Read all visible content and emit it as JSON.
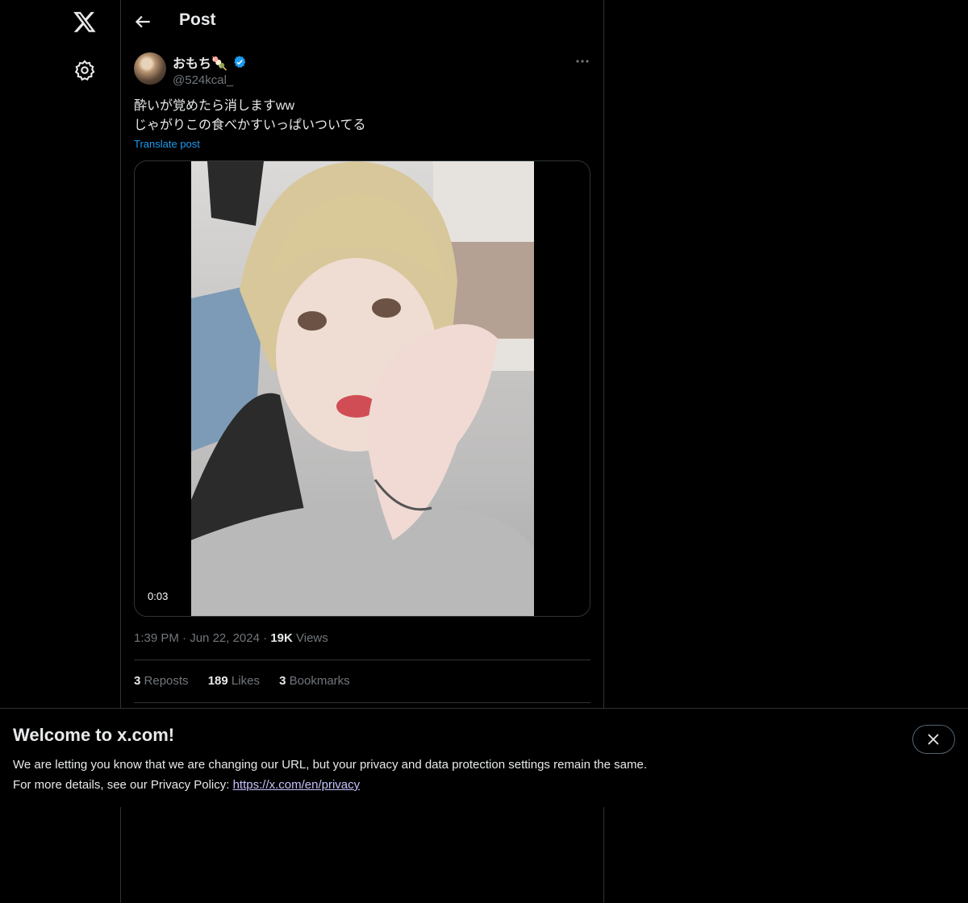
{
  "header": {
    "title": "Post"
  },
  "author": {
    "display_name": "おもち🍡",
    "handle": "@524kcal_"
  },
  "post": {
    "text": "酔いが覚めたら消しますww\nじゃがりこの食べかすいっぱいついてる",
    "translate_label": "Translate post",
    "video_duration": "0:03",
    "time": "1:39 PM",
    "date": "Jun 22, 2024",
    "views_count": "19K",
    "views_label": "Views"
  },
  "stats": {
    "reposts_count": "3",
    "reposts_label": "Reposts",
    "likes_count": "189",
    "likes_label": "Likes",
    "bookmarks_count": "3",
    "bookmarks_label": "Bookmarks"
  },
  "banner": {
    "title": "Welcome to x.com!",
    "line1": "We are letting you know that we are changing our URL, but your privacy and data protection settings remain the same.",
    "line2_prefix": "For more details, see our Privacy Policy: ",
    "link": "https://x.com/en/privacy"
  },
  "colors": {
    "background": "#000000",
    "text": "#e7e9ea",
    "muted": "#71767b",
    "accent": "#1d9bf0",
    "border": "#2f3336"
  },
  "icons": [
    "x-logo-icon",
    "settings-gear-icon",
    "back-arrow-icon",
    "verified-badge-icon",
    "more-dots-icon",
    "close-icon"
  ]
}
